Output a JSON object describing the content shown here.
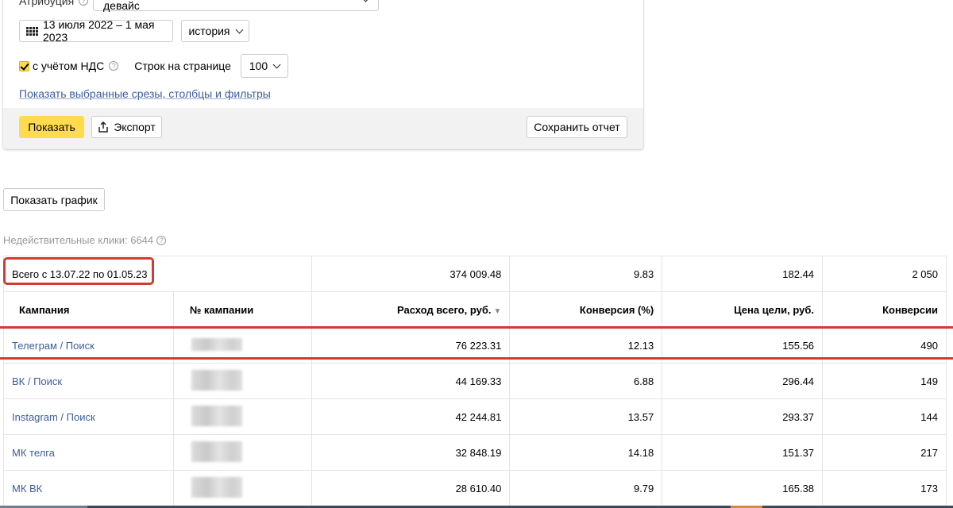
{
  "filters": {
    "attribution_label": "Атрибуция",
    "attribution_value": "последний переход из Яндекс.Директа кросс-девайс",
    "date_range": "13 июля 2022 – 1 мая 2023",
    "history_label": "история",
    "vat_label": "с учётом НДС",
    "rows_label": "Строк на странице",
    "rows_value": "100",
    "show_filters_link": "Показать выбранные срезы, столбцы и фильтры"
  },
  "footer": {
    "show_label": "Показать",
    "export_label": "Экспорт",
    "save_label": "Сохранить отчет"
  },
  "chart_button": "Показать график",
  "invalid_clicks": "Недействительные клики: 6644",
  "table": {
    "totals": {
      "label": "Всего с 13.07.22 по 01.05.23",
      "spend": "374 009.48",
      "conversion": "9.83",
      "goal_price": "182.44",
      "conversions": "2 050"
    },
    "headers": {
      "campaign": "Кампания",
      "campaign_no": "№ кампании",
      "spend": "Расход всего, руб.",
      "conversion": "Конверсия (%)",
      "goal_price": "Цена цели, руб.",
      "conversions": "Конверсии"
    },
    "rows": [
      {
        "campaign": "Телеграм / Поиск",
        "spend": "76 223.31",
        "conversion": "12.13",
        "goal_price": "155.56",
        "conversions": "490"
      },
      {
        "campaign": "ВК / Поиск",
        "spend": "44 169.33",
        "conversion": "6.88",
        "goal_price": "296.44",
        "conversions": "149"
      },
      {
        "campaign": "Instagram / Поиск",
        "spend": "42 244.81",
        "conversion": "13.57",
        "goal_price": "293.37",
        "conversions": "144"
      },
      {
        "campaign": "МК телга",
        "spend": "32 848.19",
        "conversion": "14.18",
        "goal_price": "151.37",
        "conversions": "217"
      },
      {
        "campaign": "МК ВК",
        "spend": "28 610.40",
        "conversion": "9.79",
        "goal_price": "165.38",
        "conversions": "173"
      }
    ]
  },
  "colors": {
    "accent_yellow": "#ffdb4d",
    "link_blue": "#3c5d9c",
    "highlight_red": "#d23b2f"
  }
}
